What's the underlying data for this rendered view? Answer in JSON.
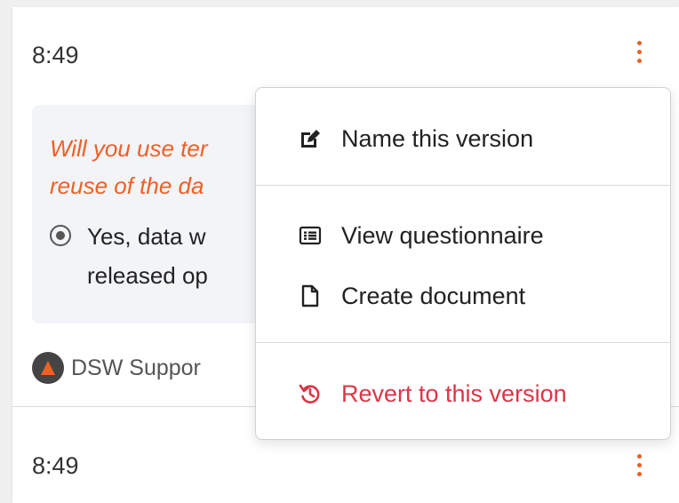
{
  "events": [
    {
      "time": "8:49",
      "question": "Will you use ter",
      "question_line2": "reuse of the da",
      "answer_line1": "Yes, data w",
      "answer_line2": "released op",
      "author": "DSW Suppor"
    },
    {
      "time": "8:49"
    }
  ],
  "menu": {
    "name_version": "Name this version",
    "view_questionnaire": "View questionnaire",
    "create_document": "Create document",
    "revert": "Revert to this version"
  },
  "colors": {
    "accent": "#f05f24",
    "danger": "#dc3545"
  }
}
